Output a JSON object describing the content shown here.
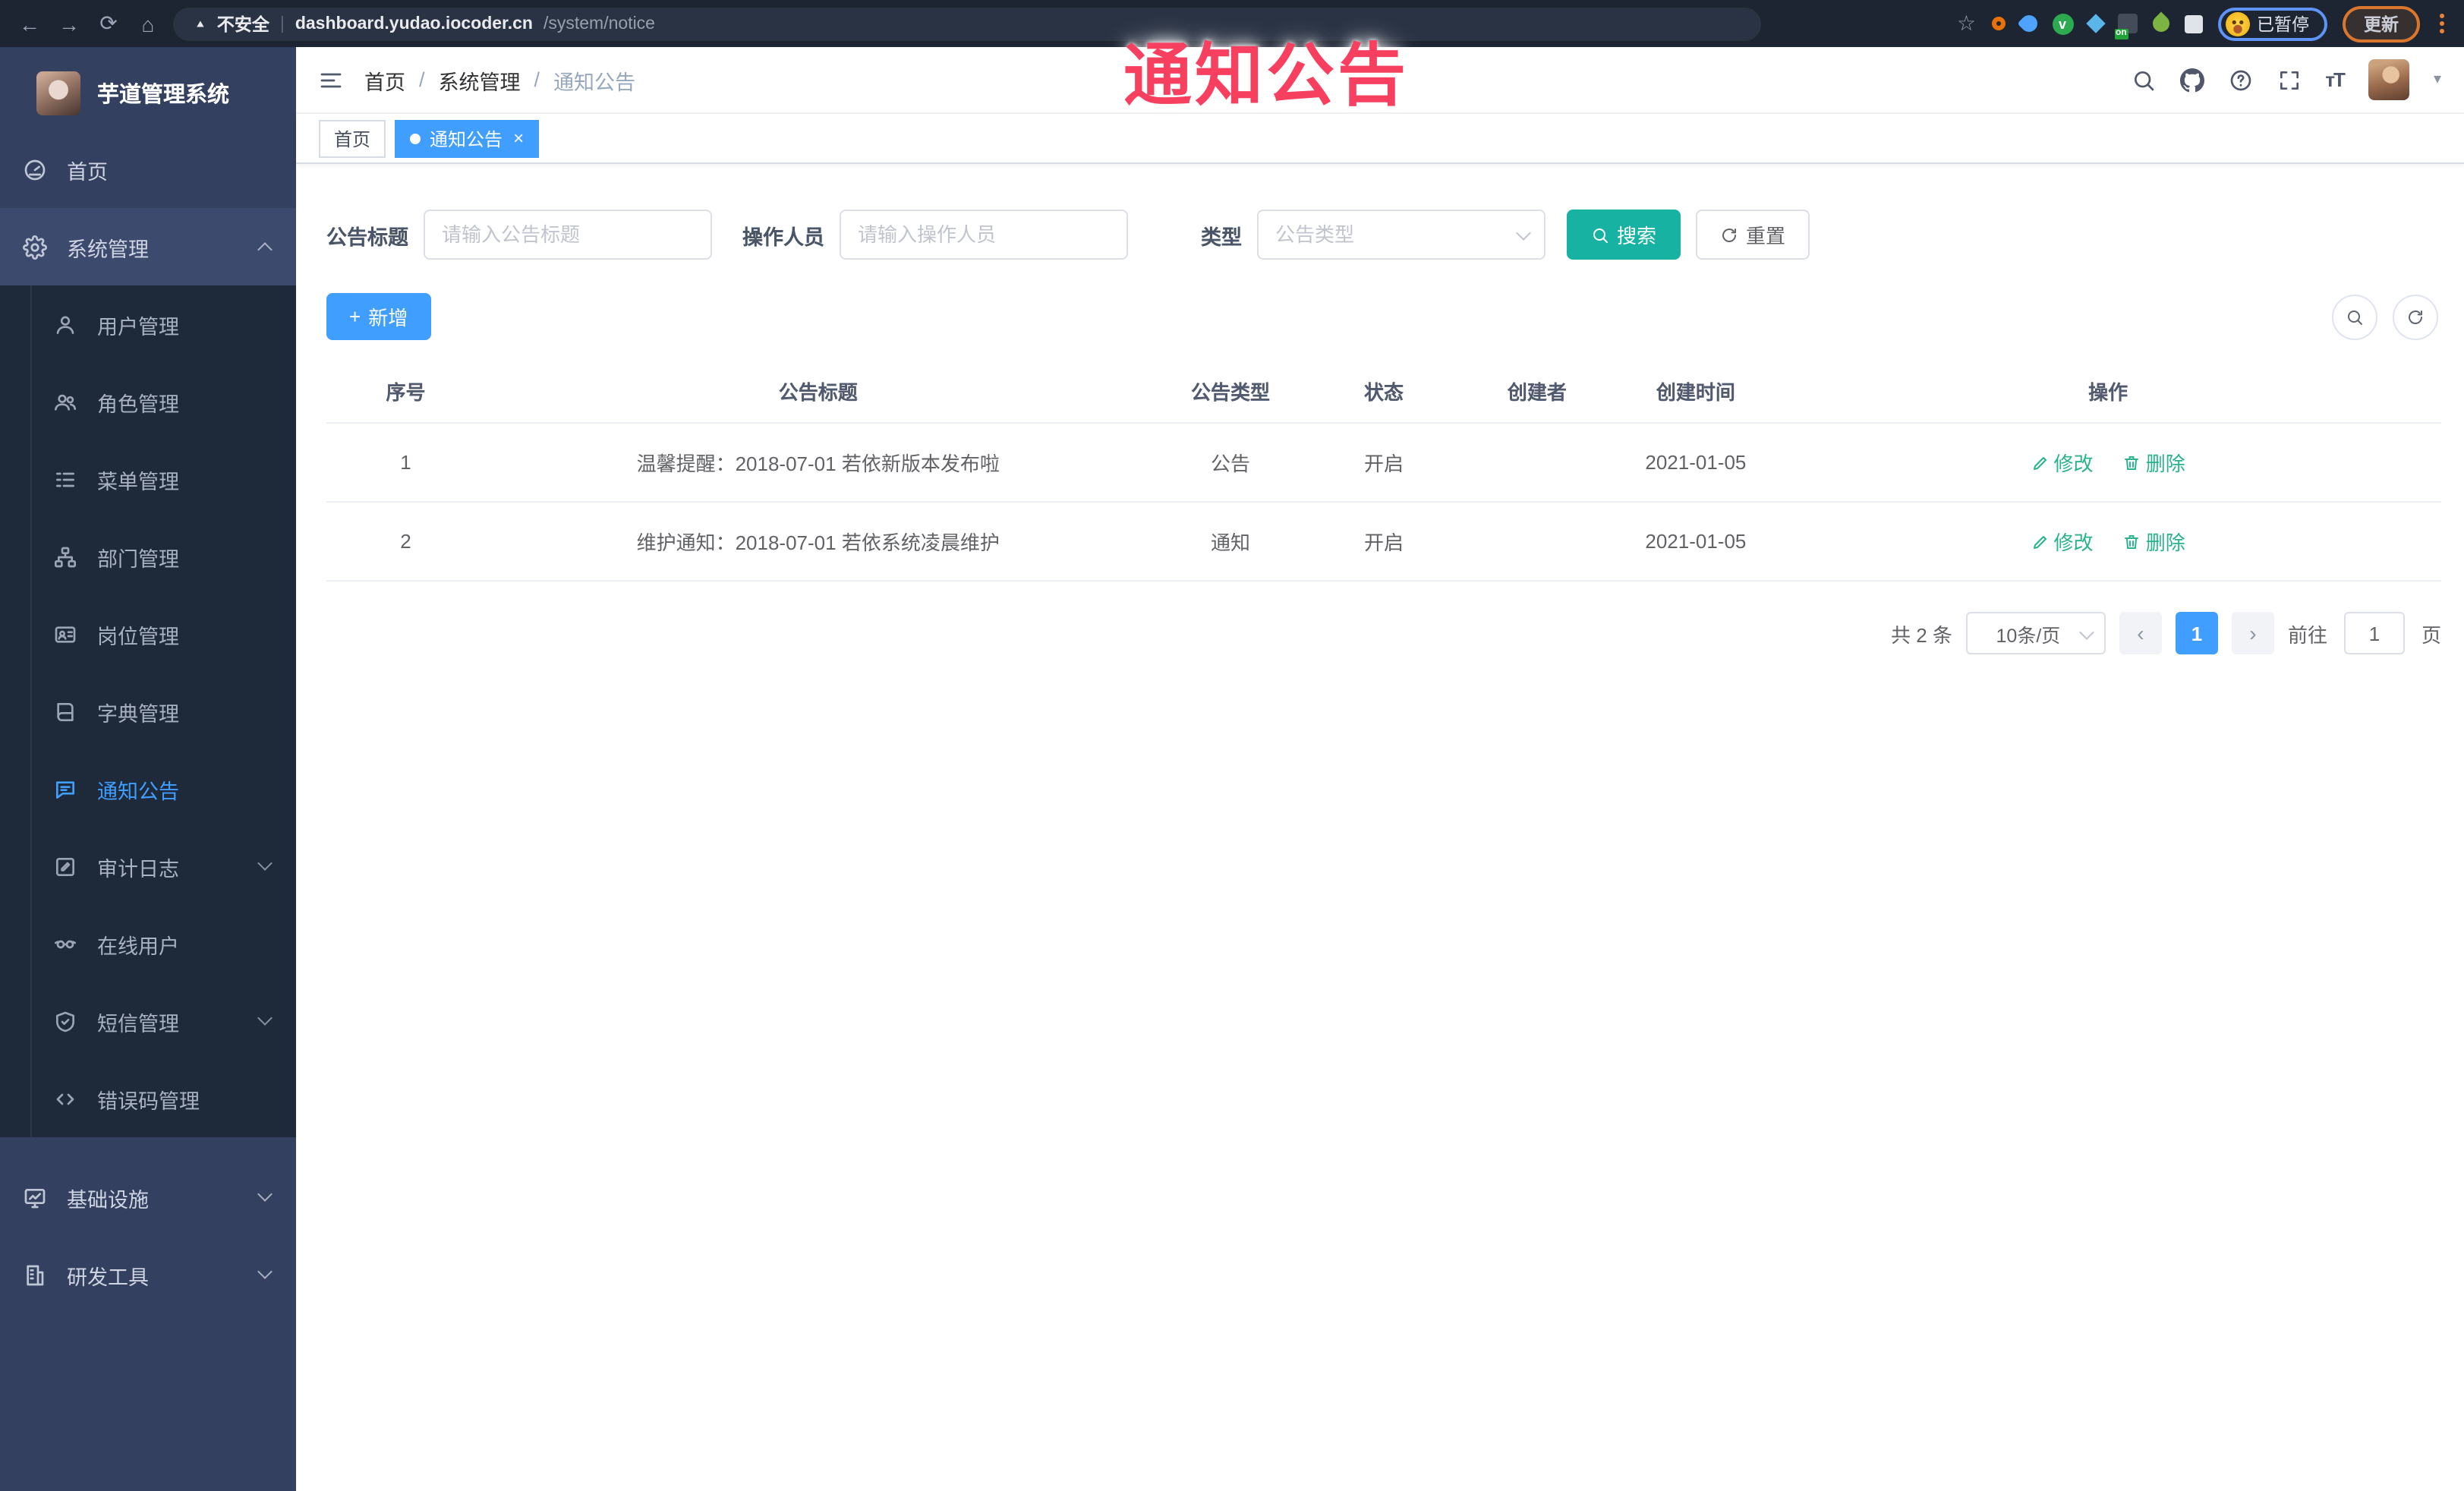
{
  "browser": {
    "security_label": "不安全",
    "url_host": "dashboard.yudao.iocoder.cn",
    "url_path": "/system/notice",
    "paused_label": "已暂停",
    "update_label": "更新",
    "extension_badge": "on"
  },
  "icons": {
    "back": "←",
    "forward": "→",
    "reload": "⟳",
    "home": "⌂",
    "warning": "▲",
    "star": "☆",
    "divider": "|",
    "caret_down": "▾",
    "font_size": "тT",
    "plus": "+",
    "close": "×",
    "chevron_left": "‹",
    "chevron_right": "›"
  },
  "overlay": {
    "text": "通知公告"
  },
  "sidebar": {
    "title": "芋道管理系统",
    "items": [
      {
        "label": "首页"
      },
      {
        "label": "系统管理"
      },
      {
        "label": "用户管理"
      },
      {
        "label": "角色管理"
      },
      {
        "label": "菜单管理"
      },
      {
        "label": "部门管理"
      },
      {
        "label": "岗位管理"
      },
      {
        "label": "字典管理"
      },
      {
        "label": "通知公告"
      },
      {
        "label": "审计日志"
      },
      {
        "label": "在线用户"
      },
      {
        "label": "短信管理"
      },
      {
        "label": "错误码管理"
      },
      {
        "label": "基础设施"
      },
      {
        "label": "研发工具"
      }
    ]
  },
  "header": {
    "breadcrumb": [
      "首页",
      "系统管理",
      "通知公告"
    ],
    "separator": "/"
  },
  "tabs": [
    {
      "label": "首页"
    },
    {
      "label": "通知公告"
    }
  ],
  "filters": {
    "title_label": "公告标题",
    "title_placeholder": "请输入公告标题",
    "operator_label": "操作人员",
    "operator_placeholder": "请输入操作人员",
    "type_label": "类型",
    "type_placeholder": "公告类型",
    "search_label": "搜索",
    "reset_label": "重置"
  },
  "toolbar": {
    "add_label": "新增"
  },
  "table": {
    "headers": [
      "序号",
      "公告标题",
      "公告类型",
      "状态",
      "创建者",
      "创建时间",
      "操作"
    ],
    "edit_label": "修改",
    "delete_label": "删除",
    "rows": [
      {
        "index": "1",
        "title": "温馨提醒：2018-07-01 若依新版本发布啦",
        "type": "公告",
        "status": "开启",
        "creator": "",
        "created": "2021-01-05"
      },
      {
        "index": "2",
        "title": "维护通知：2018-07-01 若依系统凌晨维护",
        "type": "通知",
        "status": "开启",
        "creator": "",
        "created": "2021-01-05"
      }
    ]
  },
  "pagination": {
    "total": "共 2 条",
    "page_size": "10条/页",
    "current_page": "1",
    "goto_label": "前往",
    "goto_value": "1",
    "unit_label": "页"
  },
  "colors": {
    "accent_blue": "#409eff",
    "search_teal": "#18b2a2",
    "action_green": "#28b38c",
    "overlay_red": "#f7405f",
    "sidebar_bg": "#33405f",
    "submenu_bg": "#1e2939"
  }
}
